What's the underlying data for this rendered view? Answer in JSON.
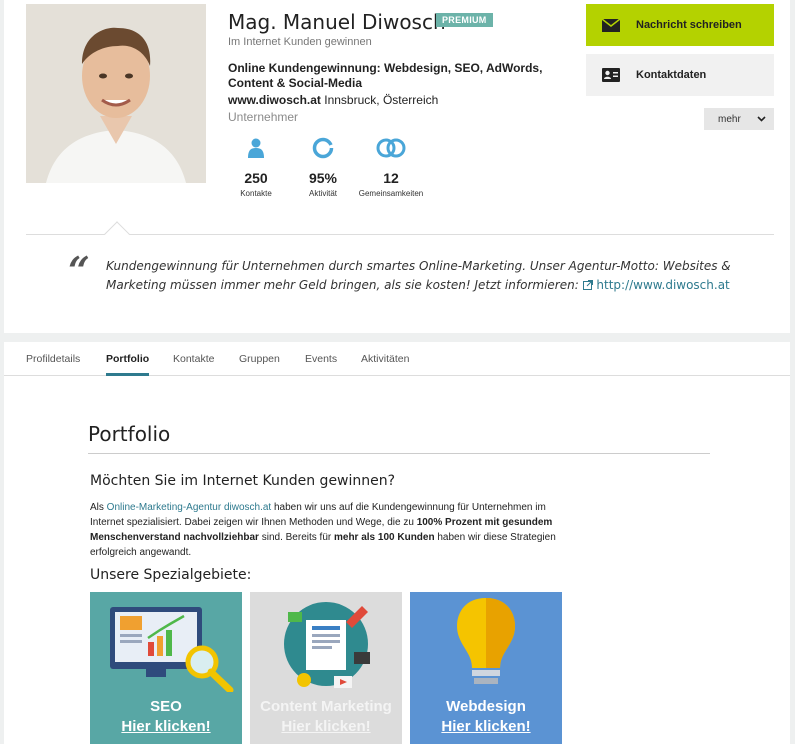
{
  "profile": {
    "name": "Mag. Manuel Diwosch",
    "badge": "PREMIUM",
    "tagline": "Im Internet Kunden gewinnen",
    "headline": "Online Kundengewinnung: Webdesign, SEO, AdWords, Content & Social-Media",
    "website": "www.diwosch.at",
    "location": "Innsbruck, Österreich",
    "role": "Unternehmer"
  },
  "stats": [
    {
      "value": "250",
      "label": "Kontakte",
      "icon": "person-icon"
    },
    {
      "value": "95%",
      "label": "Aktivität",
      "icon": "activity-ring-icon"
    },
    {
      "value": "12",
      "label": "Gemeinsamkeiten",
      "icon": "overlap-circles-icon"
    }
  ],
  "actions": {
    "message": "Nachricht schreiben",
    "contact": "Kontaktdaten",
    "more": "mehr"
  },
  "quote": {
    "text": "Kundengewinnung für Unternehmen durch smartes Online-Marketing. Unser Agentur-Motto: Websites & Marketing müssen immer mehr Geld bringen, als sie kosten! Jetzt informieren:",
    "link": "http://www.diwosch.at"
  },
  "tabs": [
    {
      "label": "Profildetails",
      "active": false
    },
    {
      "label": "Portfolio",
      "active": true
    },
    {
      "label": "Kontakte",
      "active": false
    },
    {
      "label": "Gruppen",
      "active": false
    },
    {
      "label": "Events",
      "active": false
    },
    {
      "label": "Aktivitäten",
      "active": false
    }
  ],
  "portfolio": {
    "title": "Portfolio",
    "question": "Möchten Sie im Internet Kunden gewinnen?",
    "p_pre": "Als ",
    "p_link": "Online-Marketing-Agentur diwosch.at",
    "p_mid1": " haben wir uns auf die Kundengewinnung für Unternehmen im Internet spezialisiert. Dabei zeigen wir Ihnen Methoden und Wege, die zu ",
    "p_b1": "100% Prozent mit gesundem Menschenverstand nachvollziehbar",
    "p_mid2": " sind. Bereits für ",
    "p_b2": "mehr als 100 Kunden",
    "p_end": " haben wir diese Strategien erfolgreich angewandt.",
    "specialties_title": "Unsere Spezialgebiete:",
    "tiles": [
      {
        "name": "SEO",
        "link": "Hier klicken!"
      },
      {
        "name": "Content Marketing",
        "link": "Hier klicken!"
      },
      {
        "name": "Webdesign",
        "link": "Hier klicken!"
      }
    ]
  },
  "colors": {
    "accent_green": "#b4d200",
    "link_teal": "#2e7a8e",
    "premium_badge": "#6cb3a9",
    "stat_icon_blue": "#4aa6d8"
  }
}
